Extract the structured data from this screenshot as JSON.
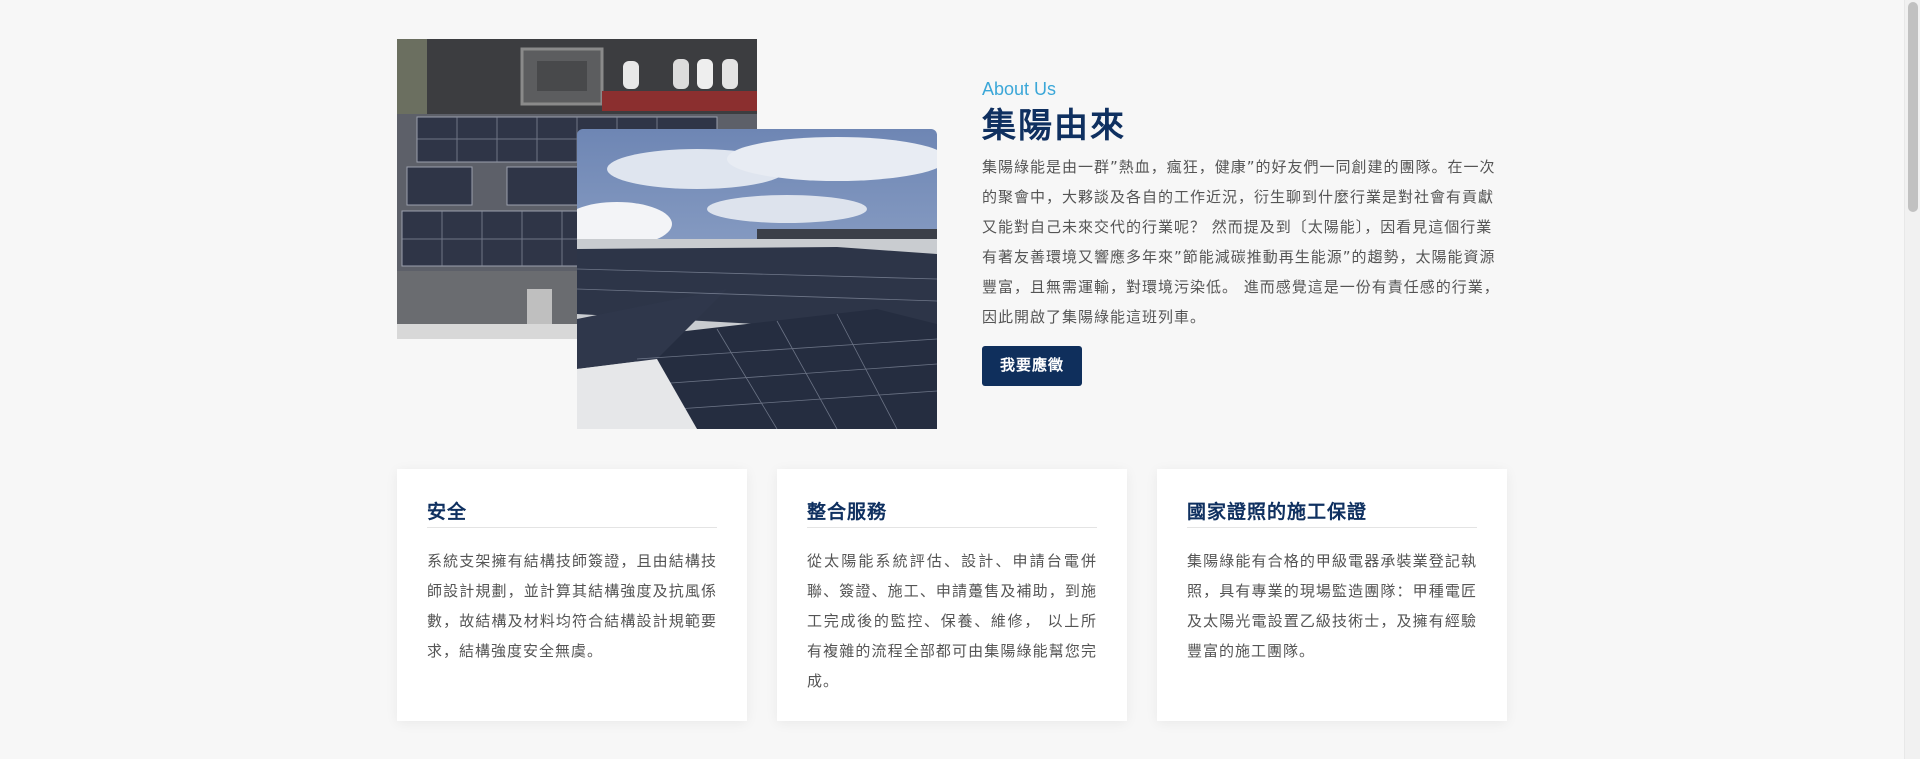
{
  "about": {
    "eyebrow": "About Us",
    "title": "集陽由來",
    "body": "集陽綠能是由一群”熱血，瘋狂，健康”的好友們一同創建的團隊。在一次的聚會中，大夥談及各自的工作近況，衍生聊到什麼行業是對社會有貢獻又能對自己未來交代的行業呢？ 然而提及到〔太陽能〕，因看見這個行業有著友善環境又響應多年來”節能減碳推動再生能源”的趨勢，太陽能資源豐富，且無需運輸，對環境污染低。 進而感覺這是一份有責任感的行業，因此開啟了集陽綠能這班列車。",
    "apply_button": "我要應徵"
  },
  "cards": [
    {
      "title": "安全",
      "body": "系統支架擁有結構技師簽證，且由結構技師設計規劃，並計算其結構強度及抗風係數，故結構及材料均符合結構設計規範要求，結構強度安全無虞。"
    },
    {
      "title": "整合服務",
      "body": "從太陽能系統評估、設計、申請台電併聯、簽證、施工、申請躉售及補助，到施工完成後的監控、保養、維修， 以上所有複雜的流程全部都可由集陽綠能幫您完成。"
    },
    {
      "title": "國家證照的施工保證",
      "body": "集陽綠能有合格的甲級電器承裝業登記執照，具有專業的現場監造團隊：甲種電匠及太陽光電設置乙級技術士，及擁有經驗豐富的施工團隊。"
    }
  ],
  "colors": {
    "accent": "#3ba7d8",
    "navy": "#0f3060",
    "button": "#0f2f5c",
    "background": "#f7f7f7"
  },
  "images": {
    "back_photo": "rooftop-solar-panels-aerial-photo",
    "front_photo": "solar-panel-array-sky-photo"
  }
}
